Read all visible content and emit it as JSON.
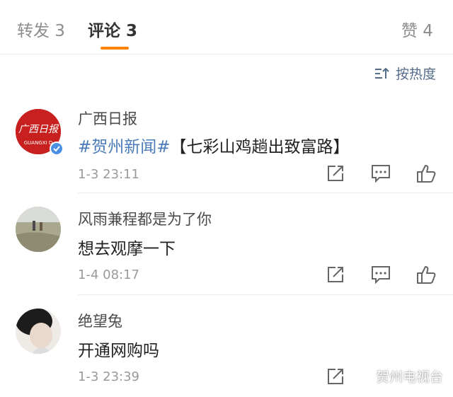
{
  "tabs": {
    "reposts": "转发 3",
    "comments": "评论 3",
    "likes": "赞 4"
  },
  "sort": {
    "label": "按热度"
  },
  "comments": [
    {
      "user": "广西日报",
      "tag": "#贺州新闻#",
      "text": "【七彩山鸡趟出致富路】",
      "time": "1-3 23:11",
      "avatar_label": "广西日报",
      "avatar_sub": "GUANGXI D"
    },
    {
      "user": "风雨兼程都是为了你",
      "text": "想去观摩一下",
      "time": "1-4 08:17"
    },
    {
      "user": "绝望兔",
      "text": "开通网购吗",
      "time": "1-3 23:39"
    }
  ],
  "watermark": {
    "label": "贺州电视台"
  },
  "colors": {
    "accent": "#ff8200",
    "link": "#4a7bb8",
    "sort": "#556b8a"
  }
}
